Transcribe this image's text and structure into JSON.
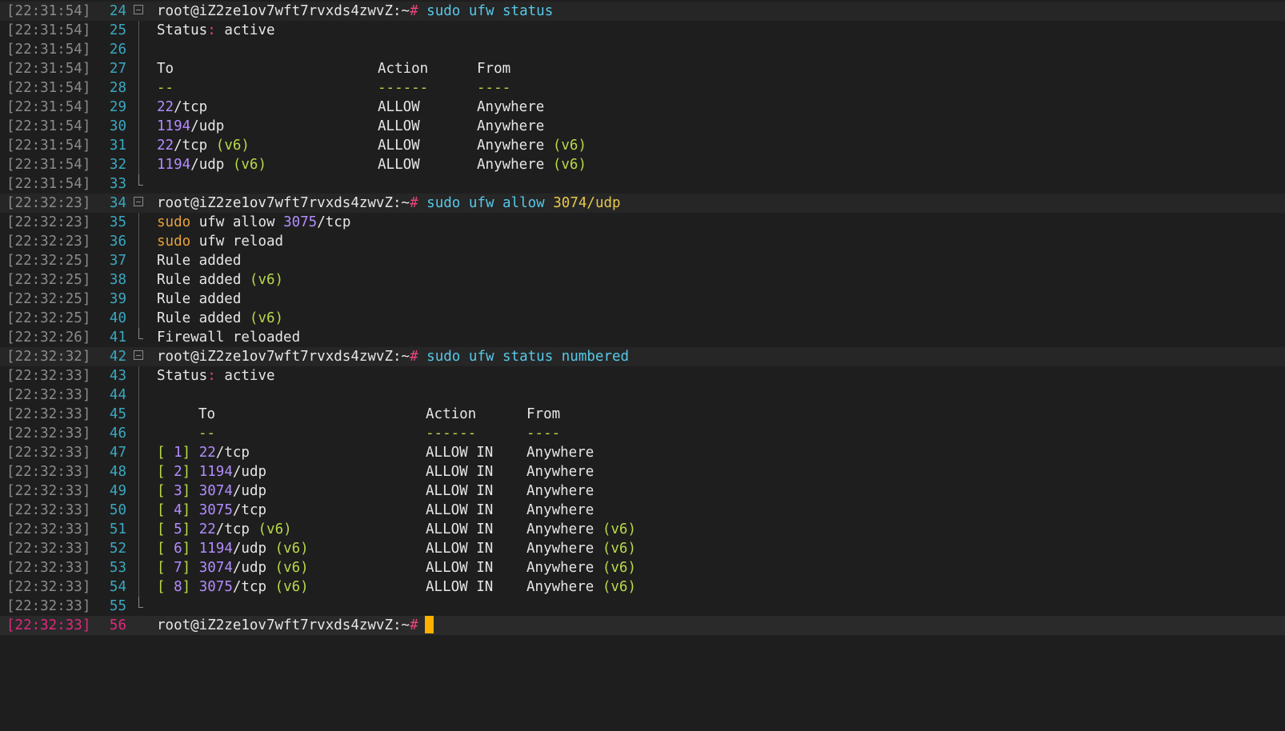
{
  "terminal": {
    "prompt": "root@iZ2ze1ov7wft7rvxds4zwvZ:~",
    "prompt_hash": "#",
    "current_timestamp": "[22:32:33]",
    "current_line": "56",
    "lines": [
      {
        "ts": "[22:31:54]",
        "ln": "24"
      },
      {
        "ts": "[22:31:54]",
        "ln": "25"
      },
      {
        "ts": "[22:31:54]",
        "ln": "26"
      },
      {
        "ts": "[22:31:54]",
        "ln": "27"
      },
      {
        "ts": "[22:31:54]",
        "ln": "28"
      },
      {
        "ts": "[22:31:54]",
        "ln": "29"
      },
      {
        "ts": "[22:31:54]",
        "ln": "30"
      },
      {
        "ts": "[22:31:54]",
        "ln": "31"
      },
      {
        "ts": "[22:31:54]",
        "ln": "32"
      },
      {
        "ts": "[22:31:54]",
        "ln": "33"
      },
      {
        "ts": "[22:32:23]",
        "ln": "34"
      },
      {
        "ts": "[22:32:23]",
        "ln": "35"
      },
      {
        "ts": "[22:32:23]",
        "ln": "36"
      },
      {
        "ts": "[22:32:25]",
        "ln": "37"
      },
      {
        "ts": "[22:32:25]",
        "ln": "38"
      },
      {
        "ts": "[22:32:25]",
        "ln": "39"
      },
      {
        "ts": "[22:32:25]",
        "ln": "40"
      },
      {
        "ts": "[22:32:26]",
        "ln": "41"
      },
      {
        "ts": "[22:32:32]",
        "ln": "42"
      },
      {
        "ts": "[22:32:33]",
        "ln": "43"
      },
      {
        "ts": "[22:32:33]",
        "ln": "44"
      },
      {
        "ts": "[22:32:33]",
        "ln": "45"
      },
      {
        "ts": "[22:32:33]",
        "ln": "46"
      },
      {
        "ts": "[22:32:33]",
        "ln": "47"
      },
      {
        "ts": "[22:32:33]",
        "ln": "48"
      },
      {
        "ts": "[22:32:33]",
        "ln": "49"
      },
      {
        "ts": "[22:32:33]",
        "ln": "50"
      },
      {
        "ts": "[22:32:33]",
        "ln": "51"
      },
      {
        "ts": "[22:32:33]",
        "ln": "52"
      },
      {
        "ts": "[22:32:33]",
        "ln": "53"
      },
      {
        "ts": "[22:32:33]",
        "ln": "54"
      },
      {
        "ts": "[22:32:33]",
        "ln": "55"
      }
    ],
    "cmd1": {
      "sudo": "sudo",
      "rest": "ufw status"
    },
    "status1": {
      "label": "Status",
      "colon": ":",
      "value": "active"
    },
    "header1": {
      "to": "To",
      "action": "Action",
      "from": "From"
    },
    "dash1": {
      "to": "--",
      "action": "------",
      "from": "----"
    },
    "rules1": [
      {
        "port": "22",
        "proto": "/tcp",
        "v6": "",
        "action": "ALLOW",
        "from": "Anywhere",
        "from_v6": ""
      },
      {
        "port": "1194",
        "proto": "/udp",
        "v6": "",
        "action": "ALLOW",
        "from": "Anywhere",
        "from_v6": ""
      },
      {
        "port": "22",
        "proto": "/tcp",
        "v6": "(v6)",
        "action": "ALLOW",
        "from": "Anywhere",
        "from_v6": "(v6)"
      },
      {
        "port": "1194",
        "proto": "/udp",
        "v6": "(v6)",
        "action": "ALLOW",
        "from": "Anywhere",
        "from_v6": "(v6)"
      }
    ],
    "cmd2": {
      "sudo": "sudo",
      "rest": "ufw allow",
      "port": "3074",
      "proto": "/udp"
    },
    "cmd2b": {
      "sudo": "sudo",
      "rest": "ufw allow",
      "port": "3075",
      "proto": "/tcp"
    },
    "cmd2c": {
      "sudo": "sudo",
      "rest": "ufw reload"
    },
    "outputs2": [
      {
        "text": "Rule added",
        "v6": ""
      },
      {
        "text": "Rule added",
        "v6": "(v6)"
      },
      {
        "text": "Rule added",
        "v6": ""
      },
      {
        "text": "Rule added",
        "v6": "(v6)"
      }
    ],
    "reloaded": "Firewall reloaded",
    "cmd3": {
      "sudo": "sudo",
      "rest": "ufw status numbered"
    },
    "status3": {
      "label": "Status",
      "colon": ":",
      "value": "active"
    },
    "header3": {
      "to": "To",
      "action": "Action",
      "from": "From"
    },
    "dash3": {
      "to": "--",
      "action": "------",
      "from": "----"
    },
    "rules3": [
      {
        "open": "[",
        "n": " 1",
        "close": "]",
        "port": "22",
        "proto": "/tcp",
        "v6": "",
        "action": "ALLOW IN",
        "from": "Anywhere",
        "from_v6": ""
      },
      {
        "open": "[",
        "n": " 2",
        "close": "]",
        "port": "1194",
        "proto": "/udp",
        "v6": "",
        "action": "ALLOW IN",
        "from": "Anywhere",
        "from_v6": ""
      },
      {
        "open": "[",
        "n": " 3",
        "close": "]",
        "port": "3074",
        "proto": "/udp",
        "v6": "",
        "action": "ALLOW IN",
        "from": "Anywhere",
        "from_v6": ""
      },
      {
        "open": "[",
        "n": " 4",
        "close": "]",
        "port": "3075",
        "proto": "/tcp",
        "v6": "",
        "action": "ALLOW IN",
        "from": "Anywhere",
        "from_v6": ""
      },
      {
        "open": "[",
        "n": " 5",
        "close": "]",
        "port": "22",
        "proto": "/tcp",
        "v6": "(v6)",
        "action": "ALLOW IN",
        "from": "Anywhere",
        "from_v6": "(v6)"
      },
      {
        "open": "[",
        "n": " 6",
        "close": "]",
        "port": "1194",
        "proto": "/udp",
        "v6": "(v6)",
        "action": "ALLOW IN",
        "from": "Anywhere",
        "from_v6": "(v6)"
      },
      {
        "open": "[",
        "n": " 7",
        "close": "]",
        "port": "3074",
        "proto": "/udp",
        "v6": "(v6)",
        "action": "ALLOW IN",
        "from": "Anywhere",
        "from_v6": "(v6)"
      },
      {
        "open": "[",
        "n": " 8",
        "close": "]",
        "port": "3075",
        "proto": "/tcp",
        "v6": "(v6)",
        "action": "ALLOW IN",
        "from": "Anywhere",
        "from_v6": "(v6)"
      }
    ],
    "colors": {
      "background": "#1e1e1e",
      "timestamp": "#8a8a8a",
      "line_number": "#3aa8c1",
      "current_line": "#e0287e",
      "command": "#56c8e8",
      "number": "#b28cff",
      "sudo_continuation": "#e8a23a",
      "paren_v6": "#b8d94a",
      "cursor": "#ffb000"
    }
  }
}
